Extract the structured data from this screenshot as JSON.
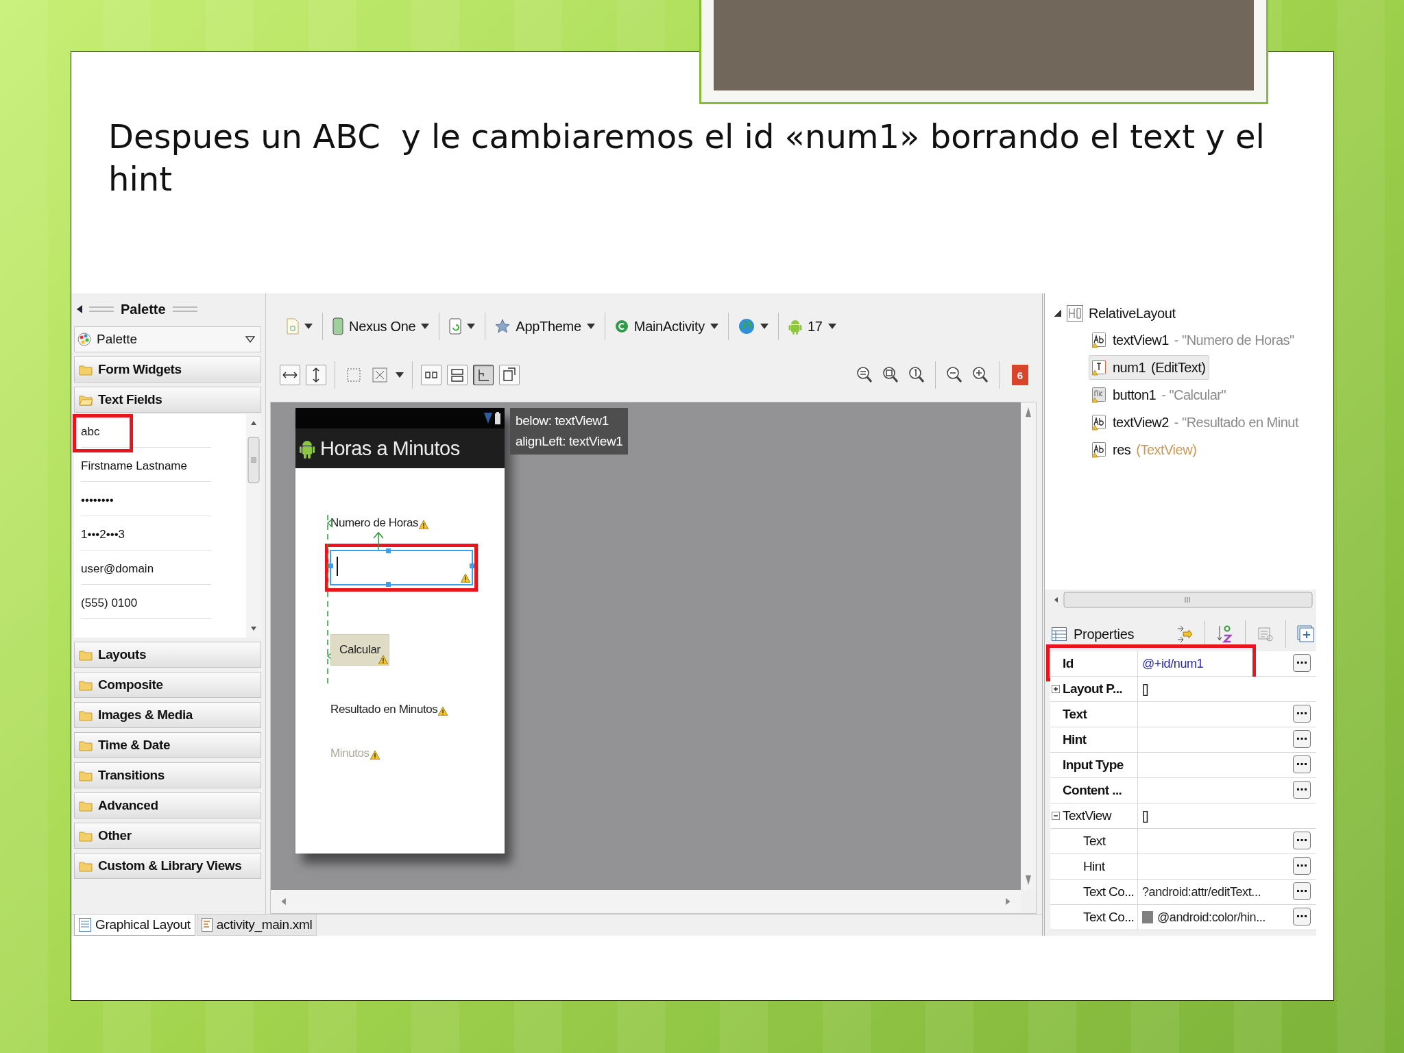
{
  "slide": {
    "text": "Despues un ABC  y le cambiaremos el id «num1» borrando el text y el hint"
  },
  "palette": {
    "title": "Palette",
    "selector": "Palette",
    "sections": [
      {
        "label": "Form Widgets",
        "expanded": false
      },
      {
        "label": "Text Fields",
        "expanded": true,
        "items": [
          {
            "label": "abc",
            "highlighted": true
          },
          {
            "label": "Firstname Lastname",
            "highlighted": false
          },
          {
            "label": "••••••••",
            "highlighted": false
          },
          {
            "label": "1•••2•••3",
            "highlighted": false
          },
          {
            "label": "user@domain",
            "highlighted": false
          },
          {
            "label": "(555) 0100",
            "highlighted": false
          }
        ]
      },
      {
        "label": "Layouts",
        "expanded": false
      },
      {
        "label": "Composite",
        "expanded": false
      },
      {
        "label": "Images & Media",
        "expanded": false
      },
      {
        "label": "Time & Date",
        "expanded": false
      },
      {
        "label": "Transitions",
        "expanded": false
      },
      {
        "label": "Advanced",
        "expanded": false
      },
      {
        "label": "Other",
        "expanded": false
      },
      {
        "label": "Custom & Library Views",
        "expanded": false
      }
    ]
  },
  "editor_tabs": [
    {
      "label": "Graphical Layout",
      "selected": true
    },
    {
      "label": "activity_main.xml",
      "selected": false
    }
  ],
  "toolbar": {
    "device": "Nexus One",
    "theme": "AppTheme",
    "activity": "MainActivity",
    "api": "17",
    "layout_modes": [
      {
        "selected": false
      },
      {
        "selected": false
      },
      {
        "selected": true
      },
      {
        "selected": false
      }
    ],
    "error_count": "6"
  },
  "canvas": {
    "app_title": "Horas a Minutos",
    "tooltip": [
      "below: textView1",
      "alignLeft: textView1"
    ],
    "widgets": [
      {
        "kind": "label",
        "text": "Numero de Horas"
      },
      {
        "kind": "edit",
        "selected": true,
        "highlighted": true
      },
      {
        "kind": "button",
        "text": "Calcular"
      },
      {
        "kind": "label",
        "text": "Resultado en Minutos"
      },
      {
        "kind": "hint",
        "text": "Minutos"
      }
    ]
  },
  "outline": {
    "root": {
      "label": "RelativeLayout",
      "expanded": true,
      "children": [
        {
          "kind": "textview",
          "name": "textView1",
          "detail": "- \"Numero de Horas\"",
          "color": "#8a8a8a",
          "selected": false
        },
        {
          "kind": "edittext",
          "name": "num1",
          "detail": "(EditText)",
          "color": "#111111",
          "selected": true
        },
        {
          "kind": "button",
          "name": "button1",
          "detail": "- \"Calcular\"",
          "color": "#8a8a8a",
          "selected": false
        },
        {
          "kind": "textview",
          "name": "textView2",
          "detail": "- \"Resultado en Minut",
          "color": "#8a8a8a",
          "selected": false
        },
        {
          "kind": "textview",
          "name": "res",
          "detail": "(TextView)",
          "color": "#c79a5a",
          "selected": false
        }
      ]
    }
  },
  "properties": {
    "title": "Properties",
    "rows": [
      {
        "kind": "id",
        "name": "Id",
        "value": "@+id/num1",
        "highlighted": true
      },
      {
        "kind": "group",
        "name": "Layout P...",
        "value": "[]",
        "expanded": false
      },
      {
        "kind": "prop",
        "name": "Text"
      },
      {
        "kind": "prop",
        "name": "Hint"
      },
      {
        "kind": "prop",
        "name": "Input Type"
      },
      {
        "kind": "prop",
        "name": "Content ..."
      },
      {
        "kind": "group",
        "name": "TextView",
        "value": "[]",
        "expanded": true,
        "children": [
          {
            "kind": "prop",
            "name": "Text"
          },
          {
            "kind": "prop",
            "name": "Hint"
          },
          {
            "kind": "prop",
            "name": "Text Co...",
            "value": "?android:attr/editText..."
          },
          {
            "kind": "prop",
            "name": "Text Co...",
            "value": "@android:color/hin...",
            "color": "#808080"
          }
        ]
      }
    ]
  }
}
